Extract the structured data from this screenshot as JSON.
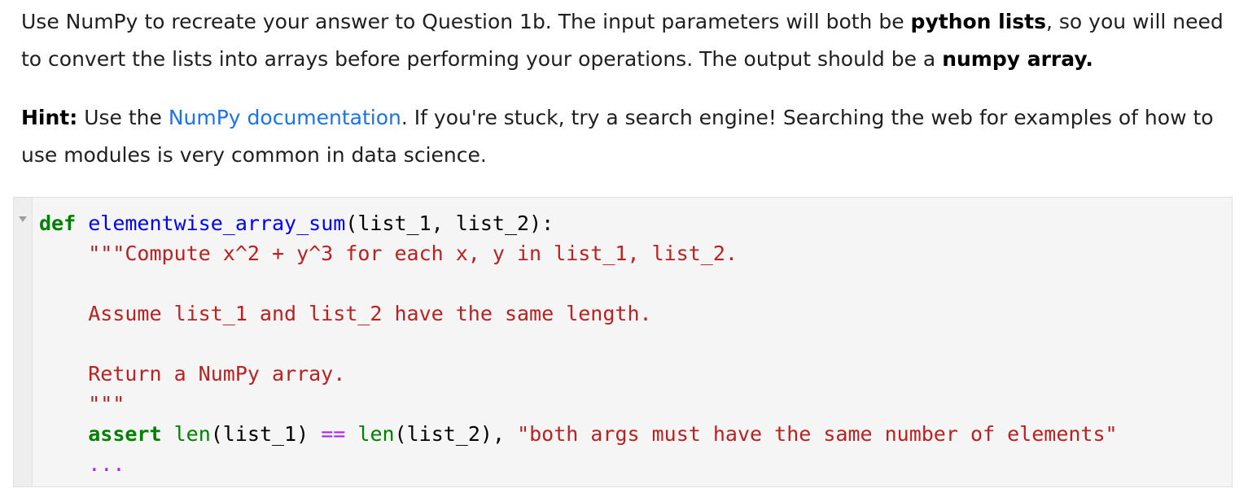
{
  "prose": {
    "para1": {
      "t1": "Use NumPy to recreate your answer to Question 1b. The input parameters will both be ",
      "b1": "python lists",
      "t2": ", so you will need to convert the lists into arrays before performing your operations. The output should be a ",
      "b2": "numpy array."
    },
    "para2": {
      "b1": "Hint:",
      "t1": " Use the ",
      "link": "NumPy documentation",
      "t2": ". If you're stuck, try a search engine! Searching the web for examples of how to use modules is very common in data science."
    }
  },
  "code": {
    "line1": {
      "kw": "def",
      "space": " ",
      "fn": "elementwise_array_sum",
      "rest": "(list_1, list_2):"
    },
    "line2": "    \"\"\"Compute x^2 + y^3 for each x, y in list_1, list_2.",
    "line3": "",
    "line4": "    Assume list_1 and list_2 have the same length.",
    "line5": "",
    "line6": "    Return a NumPy array.",
    "line7": "    \"\"\"",
    "line8": {
      "indent": "    ",
      "kw": "assert",
      "sp1": " ",
      "len1": "len",
      "arg1": "(list_1) ",
      "op": "==",
      "sp2": " ",
      "len2": "len",
      "arg2": "(list_2), ",
      "str": "\"both args must have the same number of elements\""
    },
    "line9": {
      "indent": "    ",
      "ellipsis": "..."
    }
  },
  "colors": {
    "keyword": "#008000",
    "function_name": "#0000ff",
    "string": "#ba2121",
    "operator": "#aa22ff",
    "link": "#1a73e8",
    "cell_background": "#f5f5f5"
  },
  "icons": {
    "fold": "collapse-triangle-icon"
  }
}
